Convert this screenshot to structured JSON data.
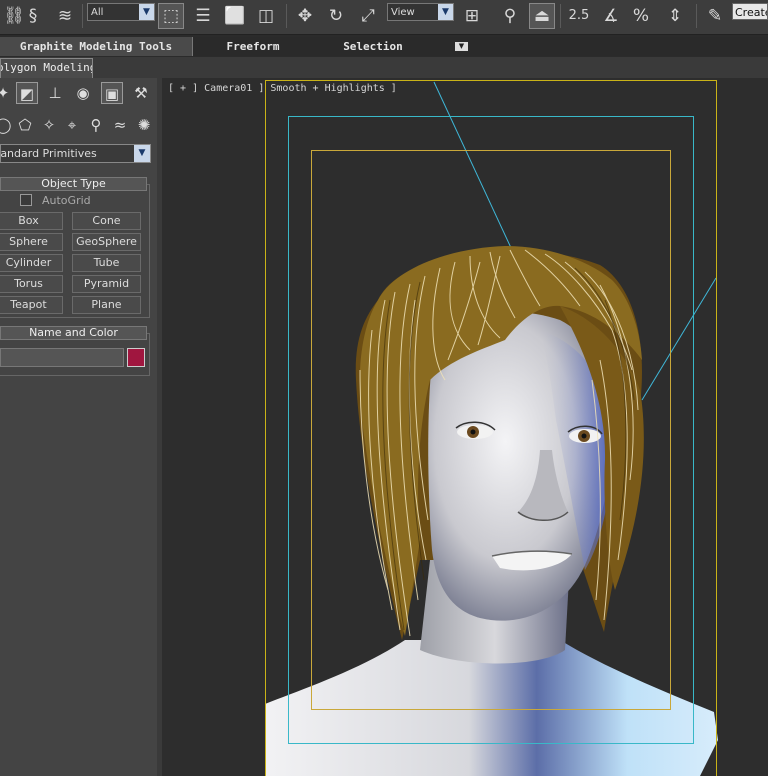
{
  "toolbar": {
    "filter_dropdown": "All",
    "refcoord_dropdown": "View",
    "snap_angle_label": "2.5",
    "snap_percent_label": "%",
    "create_selection_label": "Create",
    "icons": [
      "select-and-link-icon",
      "unlink-icon",
      "bind-spacewarp-icon",
      "select-object-icon",
      "select-by-name-icon",
      "rectangle-selection-icon",
      "window-crossing-icon",
      "move-icon",
      "rotate-icon",
      "scale-icon",
      "mirror-icon",
      "align-icon",
      "pivot-icon",
      "snap-toggle-icon",
      "angle-snap-icon",
      "percent-snap-icon",
      "spinner-snap-icon",
      "edit-named-sets-icon"
    ]
  },
  "ribbon": {
    "tabs": [
      "Graphite Modeling Tools",
      "Freeform",
      "Selection"
    ],
    "active_tab": "Graphite Modeling Tools",
    "subtab": "olygon Modeling"
  },
  "command_panel": {
    "tab_icons": [
      "create-icon",
      "modify-icon",
      "hierarchy-icon",
      "motion-icon",
      "display-icon",
      "utilities-icon"
    ],
    "category_icons": [
      "geometry-icon",
      "shapes-icon",
      "lights-icon",
      "cameras-icon",
      "helpers-icon",
      "spacewarps-icon",
      "systems-icon"
    ],
    "category_dropdown": "tandard Primitives",
    "object_type": {
      "title": "Object Type",
      "autogrid_label": "AutoGrid",
      "autogrid_checked": false,
      "buttons": [
        "Box",
        "Cone",
        "Sphere",
        "GeoSphere",
        "Cylinder",
        "Tube",
        "Torus",
        "Pyramid",
        "Teapot",
        "Plane"
      ]
    },
    "name_and_color": {
      "title": "Name and Color",
      "name_value": "",
      "color": "#a0163f"
    }
  },
  "viewport": {
    "label_plus": "+",
    "label_camera": "Camera01",
    "label_shading": "Smooth + Highlights",
    "label_template": "[ + ] Camera01 ] Smooth + Highlights ]",
    "safe_frame_colors": {
      "outer": "#c9b318",
      "action": "#39b8c8",
      "title": "#c9a83a"
    }
  }
}
